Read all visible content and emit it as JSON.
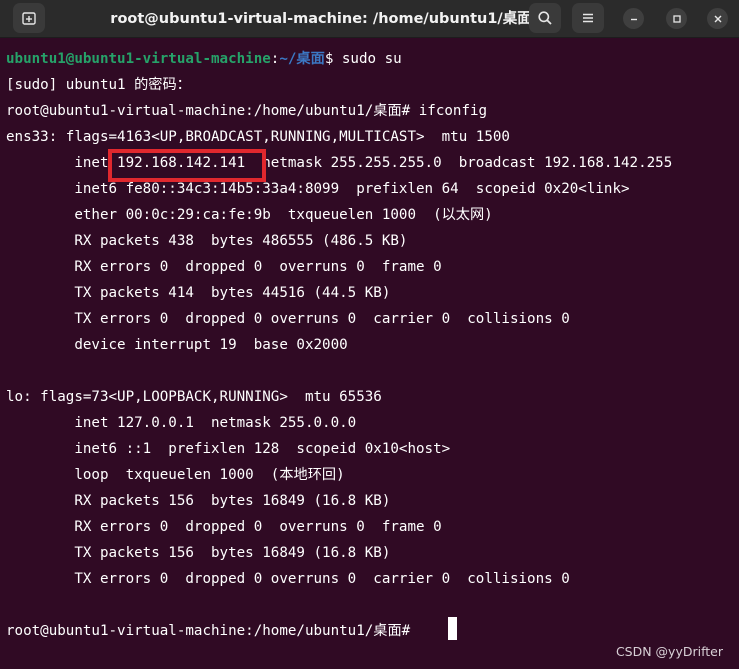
{
  "window": {
    "title": "root@ubuntu1-virtual-machine: /home/ubuntu1/桌面"
  },
  "titlebar_icons": {
    "new_tab": "new-tab-icon",
    "search": "search-icon",
    "menu": "hamburger-menu-icon",
    "minimize": "minimize-icon",
    "maximize": "maximize-icon",
    "close": "close-icon"
  },
  "terminal": {
    "prompt1": {
      "user_host": "ubuntu1@ubuntu1-virtual-machine",
      "colon": ":",
      "path": "~/桌面",
      "command": "$ sudo su"
    },
    "lines": [
      "[sudo] ubuntu1 的密码：",
      "root@ubuntu1-virtual-machine:/home/ubuntu1/桌面# ifconfig",
      "ens33: flags=4163<UP,BROADCAST,RUNNING,MULTICAST>  mtu 1500",
      "        inet 192.168.142.141  netmask 255.255.255.0  broadcast 192.168.142.255",
      "        inet6 fe80::34c3:14b5:33a4:8099  prefixlen 64  scopeid 0x20<link>",
      "        ether 00:0c:29:ca:fe:9b  txqueuelen 1000  (以太网)",
      "        RX packets 438  bytes 486555 (486.5 KB)",
      "        RX errors 0  dropped 0  overruns 0  frame 0",
      "        TX packets 414  bytes 44516 (44.5 KB)",
      "        TX errors 0  dropped 0 overruns 0  carrier 0  collisions 0",
      "        device interrupt 19  base 0x2000",
      "",
      "lo: flags=73<UP,LOOPBACK,RUNNING>  mtu 65536",
      "        inet 127.0.0.1  netmask 255.0.0.0",
      "        inet6 ::1  prefixlen 128  scopeid 0x10<host>",
      "        loop  txqueuelen 1000  (本地环回)",
      "        RX packets 156  bytes 16849 (16.8 KB)",
      "        RX errors 0  dropped 0  overruns 0  frame 0",
      "        TX packets 156  bytes 16849 (16.8 KB)",
      "        TX errors 0  dropped 0 overruns 0  carrier 0  collisions 0",
      "",
      "root@ubuntu1-virtual-machine:/home/ubuntu1/桌面# "
    ],
    "highlighted_value": "192.168.142.141"
  },
  "watermark": "CSDN @yyDrifter",
  "colors": {
    "background": "#300a24",
    "highlight": "#e0282e",
    "prompt_user": "#26a269",
    "prompt_path": "#3b78c4"
  }
}
